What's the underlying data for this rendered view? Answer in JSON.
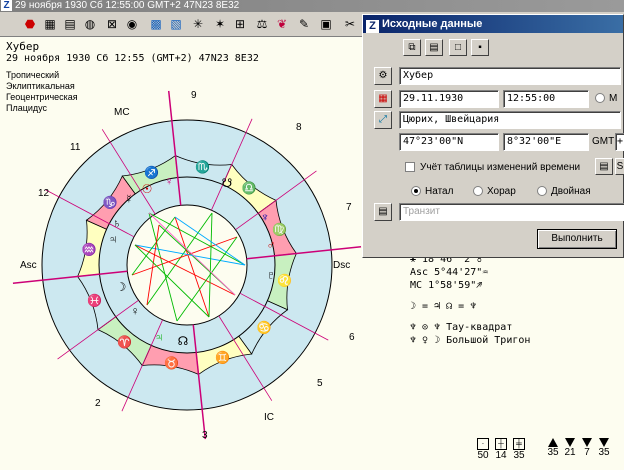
{
  "window": {
    "title": "29 ноября 1930  Сб  12:55:00 GMT+2 47N23  8E32",
    "logo": "Z"
  },
  "person": {
    "name": "Хубер",
    "info": "29 ноября 1930  Сб  12:55 (GMT+2) 47N23  8E32"
  },
  "settings": [
    "Тропический",
    "Эклиптикальная",
    "Геоцентрическая",
    "Плацидус"
  ],
  "chart_labels": {
    "asc": "Asc",
    "dsc": "Dsc",
    "mc": "MC",
    "ic": "IC",
    "houses": [
      {
        "num": "9"
      },
      {
        "num": "8"
      },
      {
        "num": "7"
      },
      {
        "num": "6"
      },
      {
        "num": "5"
      },
      {
        "num": "3"
      },
      {
        "num": "2"
      },
      {
        "num": "12"
      },
      {
        "num": "11"
      }
    ]
  },
  "positions": [
    {
      "symbol": "⚹",
      "value": "18°46' 2\"♉"
    },
    {
      "symbol": "Asc",
      "value": "5°44'27\"♒"
    },
    {
      "symbol": "MC",
      "value": "1°58'59\"♐"
    }
  ],
  "aspect_lines": [
    "☽ = ♃ ☊ = ♆",
    "♆ ⊙ ♆  Тау-квадрат",
    "♆ ♀ ☽  Большой Тригон"
  ],
  "bottom_icons": [
    {
      "icon": "square-dot",
      "label": "50"
    },
    {
      "icon": "grid",
      "label": "14"
    },
    {
      "icon": "grid2",
      "label": "35"
    },
    {
      "icon": "tri-up",
      "label": "35"
    },
    {
      "icon": "tri-down",
      "label": "21"
    },
    {
      "icon": "tri-down",
      "label": "7"
    },
    {
      "icon": "tri-down-x",
      "label": "35"
    }
  ],
  "dialog": {
    "title": "Исходные данные",
    "name_value": "Хубер",
    "date_value": "29.11.1930",
    "time_value": "12:55:00",
    "radio_m": "М",
    "place_value": "Цюрих, Швейцария",
    "lat_value": "47°23'00\"N",
    "lon_value": "8°32'00\"E",
    "gmt_label": "GMT",
    "gmt_value": "+",
    "s_button": "S",
    "dst_checkbox": "Учёт таблицы изменений времени",
    "mode_natal": "Натал",
    "mode_horar": "Хорар",
    "mode_double": "Двойная",
    "transit_placeholder": "Транзит",
    "execute_label": "Выполнить"
  },
  "colors": {
    "titlebar_active": "#0a246a",
    "zodiac_ring": "#cce8f0",
    "accent_red": "#ff0000",
    "accent_green": "#00aa00",
    "accent_magenta": "#cc0077"
  }
}
